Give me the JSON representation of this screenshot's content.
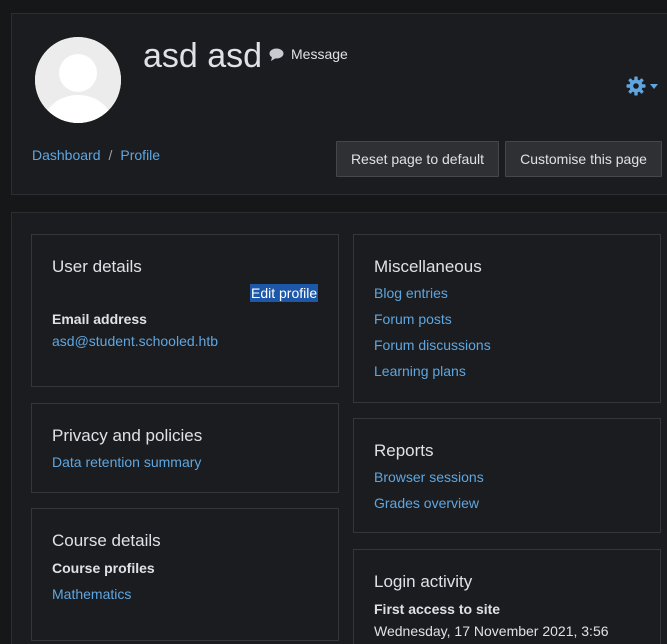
{
  "header": {
    "user_name": "asd asd",
    "message_label": "Message",
    "breadcrumb": [
      "Dashboard",
      "Profile"
    ],
    "breadcrumb_separator": "/",
    "reset_button_label": "Reset page to default",
    "customise_button_label": "Customise this page",
    "accent_color": "#5fa6e0"
  },
  "user_details": {
    "title": "User details",
    "edit_profile_label": "Edit profile",
    "email_label": "Email address",
    "email_value": "asd@student.schooled.htb"
  },
  "privacy": {
    "title": "Privacy and policies",
    "links": [
      "Data retention summary"
    ]
  },
  "course_details": {
    "title": "Course details",
    "course_profiles_label": "Course profiles",
    "courses": [
      "Mathematics"
    ]
  },
  "miscellaneous": {
    "title": "Miscellaneous",
    "links": [
      "Blog entries",
      "Forum posts",
      "Forum discussions",
      "Learning plans"
    ]
  },
  "reports": {
    "title": "Reports",
    "links": [
      "Browser sessions",
      "Grades overview"
    ]
  },
  "login_activity": {
    "title": "Login activity",
    "first_access_label": "First access to site",
    "first_access_value": "Wednesday, 17 November 2021, 3:56"
  },
  "icons": {
    "avatar": "user-avatar-icon",
    "message": "speech-bubble-icon",
    "settings": "gear-icon",
    "dropdown": "caret-down-icon"
  }
}
